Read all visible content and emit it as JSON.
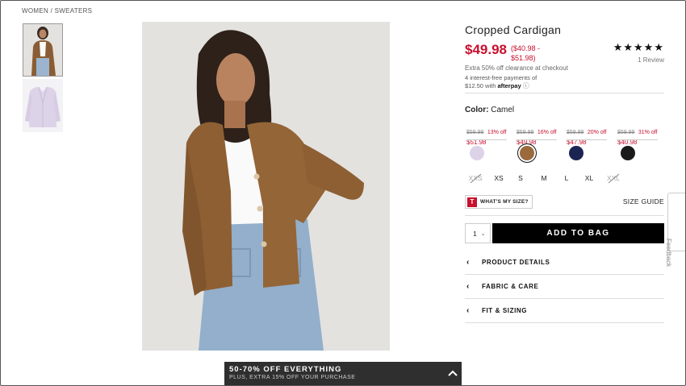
{
  "breadcrumb": "WOMEN / SWEATERS",
  "product": {
    "title": "Cropped Cardigan",
    "price": "$49.98",
    "price_range": "($40.98 - $51.98)",
    "rating": "★★★★★",
    "reviews": "1 Review",
    "extra": "Extra 50% off clearance at checkout",
    "afterpay_line1": "4 interest-free payments of",
    "afterpay_line2": "$12.50 with",
    "afterpay_brand": "afterpay",
    "afterpay_icon": "ⓘ"
  },
  "color": {
    "label": "Color:",
    "value": "Camel",
    "swatches": [
      {
        "name": "lavender",
        "hex": "#ddd3e8",
        "strike": "$59.99",
        "off": "13% off",
        "sale": "$51.98",
        "selected": false
      },
      {
        "name": "camel",
        "hex": "#9a6a3d",
        "strike": "$59.99",
        "off": "16% off",
        "sale": "$49.98",
        "selected": true
      },
      {
        "name": "navy",
        "hex": "#1c2552",
        "strike": "$59.99",
        "off": "20% off",
        "sale": "$47.98",
        "selected": false
      },
      {
        "name": "black",
        "hex": "#1a1a1a",
        "strike": "$59.99",
        "off": "31% off",
        "sale": "$40.98",
        "selected": false
      }
    ]
  },
  "sizes": [
    {
      "label": "XXS",
      "available": false
    },
    {
      "label": "XS",
      "available": true
    },
    {
      "label": "S",
      "available": true
    },
    {
      "label": "M",
      "available": true
    },
    {
      "label": "L",
      "available": true
    },
    {
      "label": "XL",
      "available": true
    },
    {
      "label": "XXL",
      "available": false
    }
  ],
  "fit": {
    "logo": "T",
    "label": "WHAT'S MY SIZE?"
  },
  "size_guide": "SIZE GUIDE",
  "quantity": {
    "value": "1",
    "chevron": "⌄"
  },
  "add_to_bag": "ADD TO BAG",
  "accordion": [
    {
      "label": "PRODUCT DETAILS",
      "chevron": "‹"
    },
    {
      "label": "FABRIC & CARE",
      "chevron": "‹"
    },
    {
      "label": "FIT & SIZING",
      "chevron": "‹"
    }
  ],
  "feedback": "Feedback",
  "promo": {
    "line1": "50-70% OFF EVERYTHING",
    "line2": "PLUS, EXTRA 15% OFF YOUR PURCHASE"
  },
  "colors": {
    "sale_red": "#c8102e",
    "button_black": "#000000",
    "banner": "#2f2f2f"
  }
}
